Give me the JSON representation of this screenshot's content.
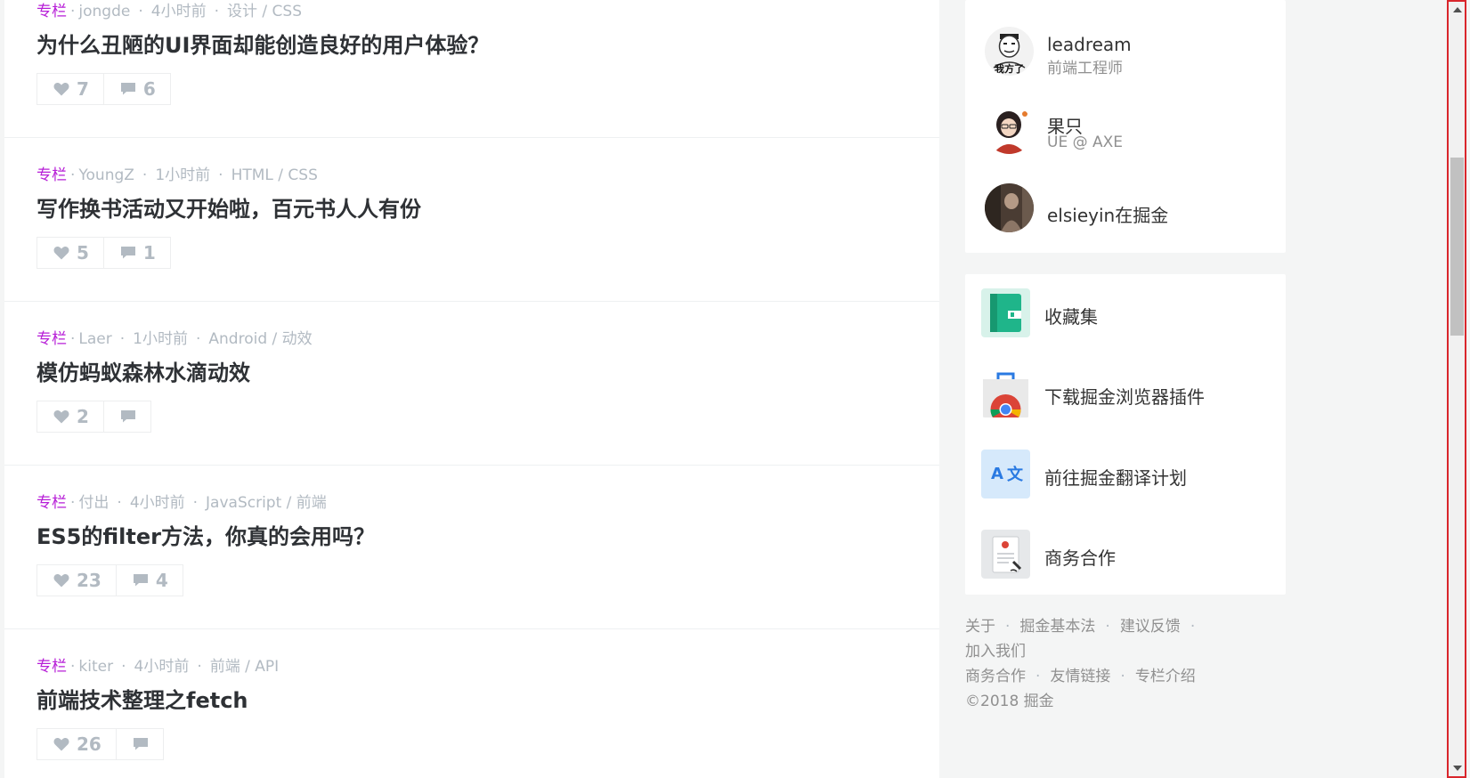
{
  "entries": [
    {
      "tag": "专栏",
      "author": "jongde",
      "time": "4小时前",
      "category": "设计 / CSS",
      "title": "为什么丑陋的UI界面却能创造良好的用户体验？",
      "likes": "7",
      "comments": "6"
    },
    {
      "tag": "专栏",
      "author": "YoungZ",
      "time": "1小时前",
      "category": "HTML / CSS",
      "title": "写作换书活动又开始啦，百元书人人有份",
      "likes": "5",
      "comments": "1"
    },
    {
      "tag": "专栏",
      "author": "Laer",
      "time": "1小时前",
      "category": "Android / 动效",
      "title": "模仿蚂蚁森林水滴动效",
      "likes": "2",
      "comments": ""
    },
    {
      "tag": "专栏",
      "author": "付出",
      "time": "4小时前",
      "category": "JavaScript / 前端",
      "title": "ES5的filter方法，你真的会用吗？",
      "likes": "23",
      "comments": "4"
    },
    {
      "tag": "专栏",
      "author": "kiter",
      "time": "4小时前",
      "category": "前端 / API",
      "title": "前端技术整理之fetch",
      "likes": "26",
      "comments": ""
    }
  ],
  "authors": [
    {
      "name": "leadream",
      "role": "前端工程师",
      "avatar_text": "我方了"
    },
    {
      "name": "果只",
      "role": "UE @ AXE"
    },
    {
      "name": "elsieyin在掘金",
      "role": ""
    }
  ],
  "links": [
    {
      "label": "收藏集",
      "icon": "collection-icon"
    },
    {
      "label": "下载掘金浏览器插件",
      "icon": "chrome-extension-icon"
    },
    {
      "label": "前往掘金翻译计划",
      "icon": "translate-icon"
    },
    {
      "label": "商务合作",
      "icon": "business-contract-icon"
    }
  ],
  "translate_icon_text": {
    "a": "A",
    "wen": "文"
  },
  "footer": {
    "about": "关于",
    "basic_law": "掘金基本法",
    "feedback": "建议反馈",
    "join": "加入我们",
    "business": "商务合作",
    "friend_links": "友情链接",
    "column_intro": "专栏介绍",
    "copyright": "©2018 掘金"
  },
  "colors": {
    "tag": "#b71ed7",
    "meta": "#b2bac2",
    "collection": "#1fb58a",
    "scrollbar_border": "#d9262c"
  }
}
